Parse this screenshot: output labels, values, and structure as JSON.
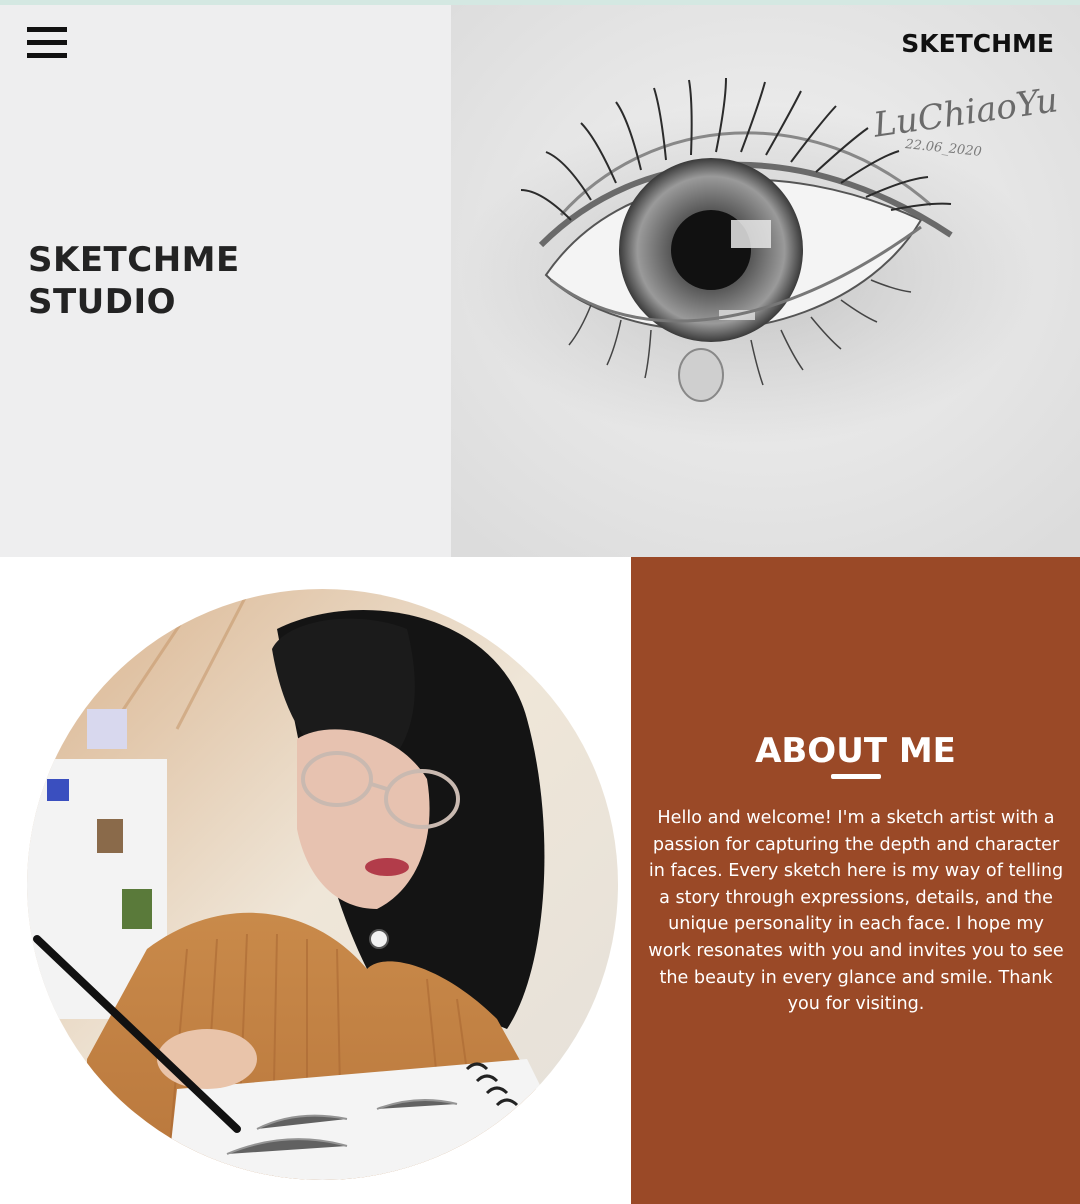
{
  "header": {
    "menu_icon": "hamburger-menu-icon",
    "brand": "SKETCHME"
  },
  "hero": {
    "title_line1": "SKETCHME",
    "title_line2": "STUDIO",
    "artwork": {
      "subject": "pencil-sketch-eye",
      "signature": "LuChiaoYu",
      "signature_date": "22.06_2020"
    }
  },
  "about": {
    "heading": "ABOUT ME",
    "body": "Hello and welcome! I'm a sketch artist with a passion for capturing the depth and character in faces. Every sketch here is my way of telling a story through expressions, details, and the unique personality in each face. I hope my work resonates with you and invites you to see the beauty in every glance and smile. Thank you for visiting."
  },
  "colors": {
    "accent_brown": "#9a4927",
    "hero_left_bg": "#eeeeef",
    "top_accent": "#d4e8e2",
    "text_dark": "#232323"
  }
}
